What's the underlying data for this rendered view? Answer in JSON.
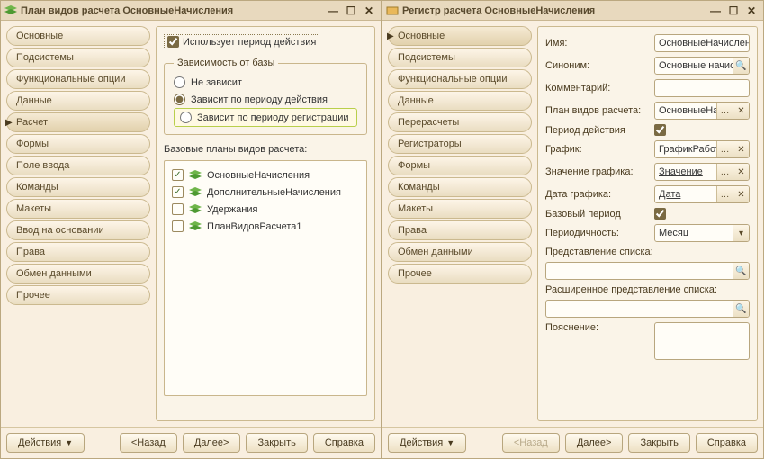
{
  "left": {
    "title": "План видов расчета ОсновныеНачисления",
    "sidebar": [
      {
        "label": "Основные"
      },
      {
        "label": "Подсистемы"
      },
      {
        "label": "Функциональные опции"
      },
      {
        "label": "Данные"
      },
      {
        "label": "Расчет",
        "active": true
      },
      {
        "label": "Формы"
      },
      {
        "label": "Поле ввода"
      },
      {
        "label": "Команды"
      },
      {
        "label": "Макеты"
      },
      {
        "label": "Ввод на основании"
      },
      {
        "label": "Права"
      },
      {
        "label": "Обмен данными"
      },
      {
        "label": "Прочее"
      }
    ],
    "content": {
      "use_period": "Использует период действия",
      "group_title": "Зависимость от базы",
      "radio_none": "Не зависит",
      "radio_period_action": "Зависит по периоду действия",
      "radio_period_reg": "Зависит по периоду регистрации",
      "base_plans_label": "Базовые планы видов расчета:",
      "plans": [
        {
          "label": "ОсновныеНачисления",
          "checked": true
        },
        {
          "label": "ДополнительныеНачисления",
          "checked": true
        },
        {
          "label": "Удержания",
          "checked": false
        },
        {
          "label": "ПланВидовРасчета1",
          "checked": false
        }
      ]
    },
    "footer": {
      "actions": "Действия",
      "back": "<Назад",
      "next": "Далее>",
      "close": "Закрыть",
      "help": "Справка"
    }
  },
  "right": {
    "title": "Регистр расчета ОсновныеНачисления",
    "sidebar": [
      {
        "label": "Основные",
        "active": true
      },
      {
        "label": "Подсистемы"
      },
      {
        "label": "Функциональные опции"
      },
      {
        "label": "Данные"
      },
      {
        "label": "Перерасчеты"
      },
      {
        "label": "Регистраторы"
      },
      {
        "label": "Формы"
      },
      {
        "label": "Команды"
      },
      {
        "label": "Макеты"
      },
      {
        "label": "Права"
      },
      {
        "label": "Обмен данными"
      },
      {
        "label": "Прочее"
      }
    ],
    "form": {
      "name_lbl": "Имя:",
      "name_val": "ОсновныеНачисления",
      "syn_lbl": "Синоним:",
      "syn_val": "Основные начисления",
      "comment_lbl": "Комментарий:",
      "comment_val": "",
      "plan_lbl": "План видов расчета:",
      "plan_val": "ОсновныеНачисления",
      "period_lbl": "Период действия",
      "chart_lbl": "График:",
      "chart_val": "ГрафикРаботы",
      "chartval_lbl": "Значение графика:",
      "chartval_val": "Значение",
      "chartdate_lbl": "Дата графика:",
      "chartdate_val": "Дата",
      "base_period_lbl": "Базовый период",
      "periodicity_lbl": "Периодичность:",
      "periodicity_val": "Месяц",
      "list_repr_lbl": "Представление списка:",
      "ext_list_repr_lbl": "Расширенное представление списка:",
      "expl_lbl": "Пояснение:"
    },
    "footer": {
      "actions": "Действия",
      "back": "<Назад",
      "next": "Далее>",
      "close": "Закрыть",
      "help": "Справка"
    }
  }
}
